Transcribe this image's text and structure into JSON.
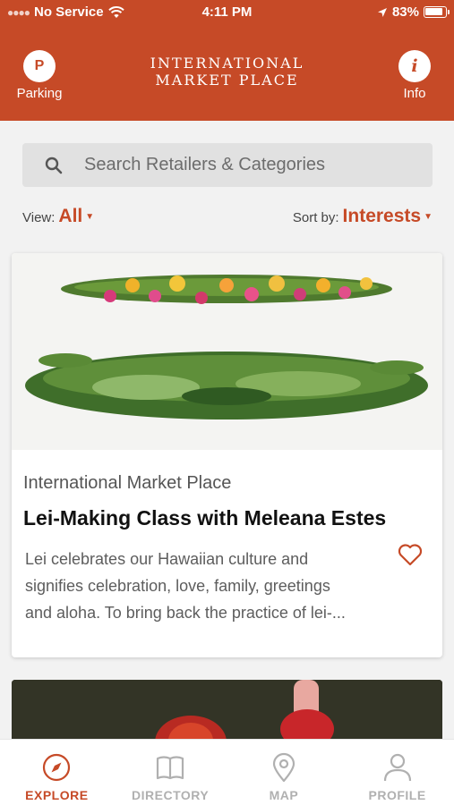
{
  "status": {
    "carrier": "No Service",
    "time": "4:11 PM",
    "battery": "83%"
  },
  "header": {
    "parking_icon_text": "P",
    "parking_label": "Parking",
    "logo_line1": "INTERNATIONAL",
    "logo_line2": "MARKET PLACE",
    "info_icon_text": "i",
    "info_label": "Info"
  },
  "search": {
    "placeholder": "Search Retailers & Categories"
  },
  "filters": {
    "view_label": "View:",
    "view_value": "All",
    "sort_label": "Sort by:",
    "sort_value": "Interests"
  },
  "card": {
    "venue": "International Market Place",
    "title": "Lei-Making Class with Meleana Estes",
    "description_lines": [
      "Lei celebrates our Hawaiian culture and",
      "signifies celebration, love, family, greetings",
      "and aloha. To bring back the practice of lei-..."
    ]
  },
  "tabs": [
    {
      "label": "EXPLORE",
      "icon": "compass-icon",
      "active": true
    },
    {
      "label": "DIRECTORY",
      "icon": "book-icon",
      "active": false
    },
    {
      "label": "MAP",
      "icon": "map-pin-icon",
      "active": false
    },
    {
      "label": "PROFILE",
      "icon": "person-icon",
      "active": false
    }
  ],
  "colors": {
    "brand": "#c64a27",
    "tab_inactive": "#b0b0b0"
  }
}
